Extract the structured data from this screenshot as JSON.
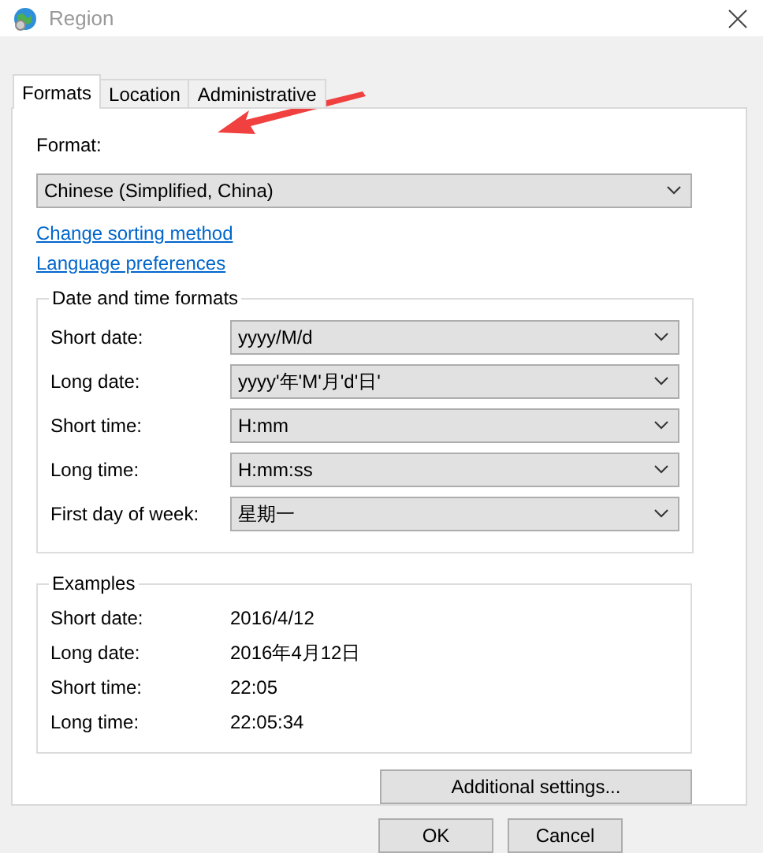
{
  "window": {
    "title": "Region",
    "active": false
  },
  "tabs": [
    {
      "label": "Formats",
      "selected": true
    },
    {
      "label": "Location",
      "selected": false
    },
    {
      "label": "Administrative",
      "selected": false
    }
  ],
  "format": {
    "label": "Format:",
    "value": "Chinese (Simplified, China)"
  },
  "links": [
    "Change sorting method",
    "Language preferences"
  ],
  "date_time_formats": {
    "title": "Date and time formats",
    "rows": [
      {
        "label": "Short date:",
        "value": "yyyy/M/d"
      },
      {
        "label": "Long date:",
        "value": "yyyy'年'M'月'd'日'"
      },
      {
        "label": "Short time:",
        "value": "H:mm"
      },
      {
        "label": "Long time:",
        "value": "H:mm:ss"
      },
      {
        "label": "First day of week:",
        "value": "星期一"
      }
    ]
  },
  "examples": {
    "title": "Examples",
    "rows": [
      {
        "label": "Short date:",
        "value": "2016/4/12"
      },
      {
        "label": "Long date:",
        "value": "2016年4月12日"
      },
      {
        "label": "Short time:",
        "value": "22:05"
      },
      {
        "label": "Long time:",
        "value": "22:05:34"
      }
    ]
  },
  "additional_button": "Additional settings...",
  "buttons": [
    "OK",
    "Cancel"
  ]
}
